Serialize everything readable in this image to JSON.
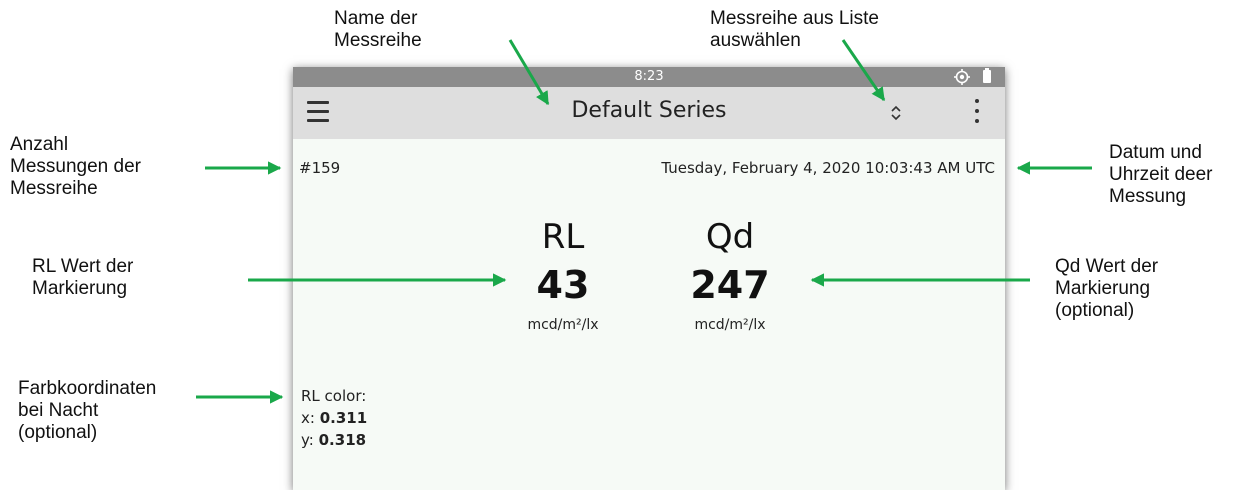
{
  "device": {
    "status_time": "8:23",
    "title": "Default Series",
    "measurement_count": "#159",
    "datetime": "Tuesday, February 4, 2020 10:03:43 AM UTC",
    "rl": {
      "label": "RL",
      "value": "43",
      "unit": "mcd/m²/lx"
    },
    "qd": {
      "label": "Qd",
      "value": "247",
      "unit": "mcd/m²/lx"
    },
    "rl_color": {
      "label": "RL color:",
      "x_label": "x:",
      "x_value": "0.311",
      "y_label": "y:",
      "y_value": "0.318"
    },
    "icons": [
      "menu-icon",
      "location-icon",
      "battery-icon",
      "selector-icon",
      "more-vert-icon"
    ]
  },
  "annotations": {
    "series_name": [
      "Name der",
      "Messreihe"
    ],
    "series_select": [
      "Messreihe aus Liste",
      "auswählen"
    ],
    "count": [
      "Anzahl",
      "Messungen der",
      "Messreihe"
    ],
    "datetime": [
      "Datum und",
      "Uhrzeit deer",
      "Messung"
    ],
    "rl": [
      "RL Wert der",
      "Markierung"
    ],
    "qd": [
      "Qd Wert der",
      "Markierung",
      "(optional)"
    ],
    "color": [
      "Farbkoordinaten",
      "bei Nacht",
      "(optional)"
    ]
  },
  "colors": {
    "arrow": "#1aa84a",
    "statusbar": "#8c8c8c",
    "appbar": "#dedede",
    "screen": "#f6faf6"
  }
}
